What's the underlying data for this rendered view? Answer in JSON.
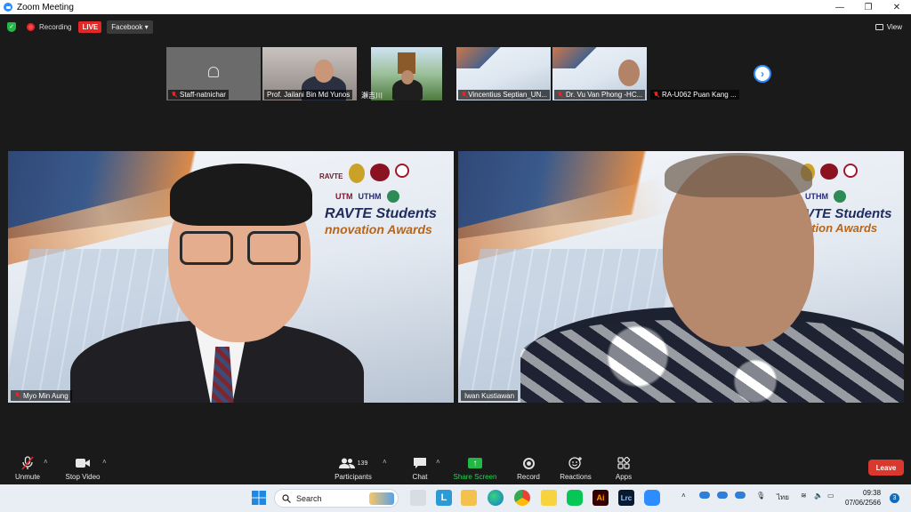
{
  "window": {
    "title": "Zoom Meeting"
  },
  "topbar": {
    "recording_label": "Recording",
    "live_label": "LIVE",
    "stream_target": "Facebook",
    "view_label": "View"
  },
  "thumbnails": [
    {
      "name": "Staff-natnichar"
    },
    {
      "name": "Prof. Jailani Bin Md Yunos"
    },
    {
      "name": "瀬吉川"
    },
    {
      "name": "Vincentius Septian_UN..."
    },
    {
      "name": "Dr. Vu Van Phong -HC..."
    },
    {
      "name": "RA-U062 Puan Kang ..."
    }
  ],
  "tiles": [
    {
      "name": "Myo Min Aung",
      "poster_line1": "RAVTE Students",
      "poster_line2": "nnovation Awards",
      "logos": [
        "UTM",
        "UTHM",
        "RAVTE"
      ]
    },
    {
      "name": "Iwan Kustiawan",
      "poster_line1": "VTE Students",
      "poster_line2": "ation Awards",
      "logos": [
        "UTHM"
      ]
    }
  ],
  "toolbar": {
    "unmute": "Unmute",
    "stop_video": "Stop Video",
    "participants": "Participants",
    "participants_count": "139",
    "chat": "Chat",
    "share_screen": "Share Screen",
    "record": "Record",
    "reactions": "Reactions",
    "apps": "Apps",
    "leave": "Leave"
  },
  "taskbar": {
    "search_placeholder": "Search",
    "language": "ไทย",
    "time": "09:38",
    "date": "07/06/2566",
    "notifications": "3"
  },
  "colors": {
    "accent": "#2d8cff",
    "live": "#e02828",
    "share": "#23b845",
    "leave": "#d9382e"
  }
}
